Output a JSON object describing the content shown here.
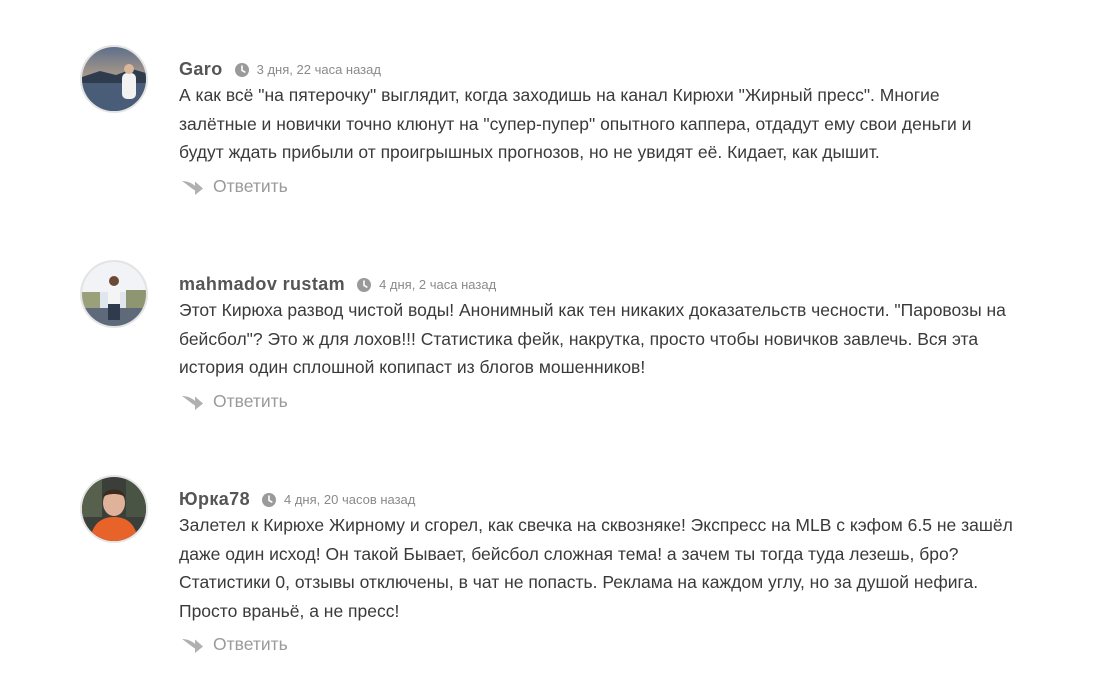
{
  "reply_label": "Ответить",
  "comments": [
    {
      "author": "Garo",
      "time": "3 дня, 22 часа назад",
      "text": "А как всё \"на пятерочку\" выглядит, когда заходишь на канал Кирюхи \"Жирный пресс\". Многие залётные и новички точно клюнут на \"супер-пупер\" опытного каппера, отдадут ему свои деньги и будут ждать прибыли от проигрышных прогнозов, но не увидят её. Кидает, как дышит."
    },
    {
      "author": "mahmadov rustam",
      "time": "4 дня, 2 часа назад",
      "text": "Этот Кирюха развод чистой воды! Анонимный как тен никаких доказательств чесности. \"Паровозы на бейсбол\"? Это ж для лохов!!! Статистика фейк, накрутка, просто чтобы новичков завлечь. Вся эта история один сплошной копипаст из блогов мошенников!"
    },
    {
      "author": "Юрка78",
      "time": "4 дня, 20 часов назад",
      "text": "Залетел к Кирюхе Жирному и сгорел, как свечка на сквозняке! Экспресс на MLB с кэфом 6.5 не зашёл даже один исход! Он такой Бывает, бейсбол сложная тема! а зачем ты тогда туда лезешь, бро? Статистики 0, отзывы отключены, в чат не попасть. Реклама на каждом углу, но за душой нефига. Просто враньё, а не пресс!"
    }
  ]
}
